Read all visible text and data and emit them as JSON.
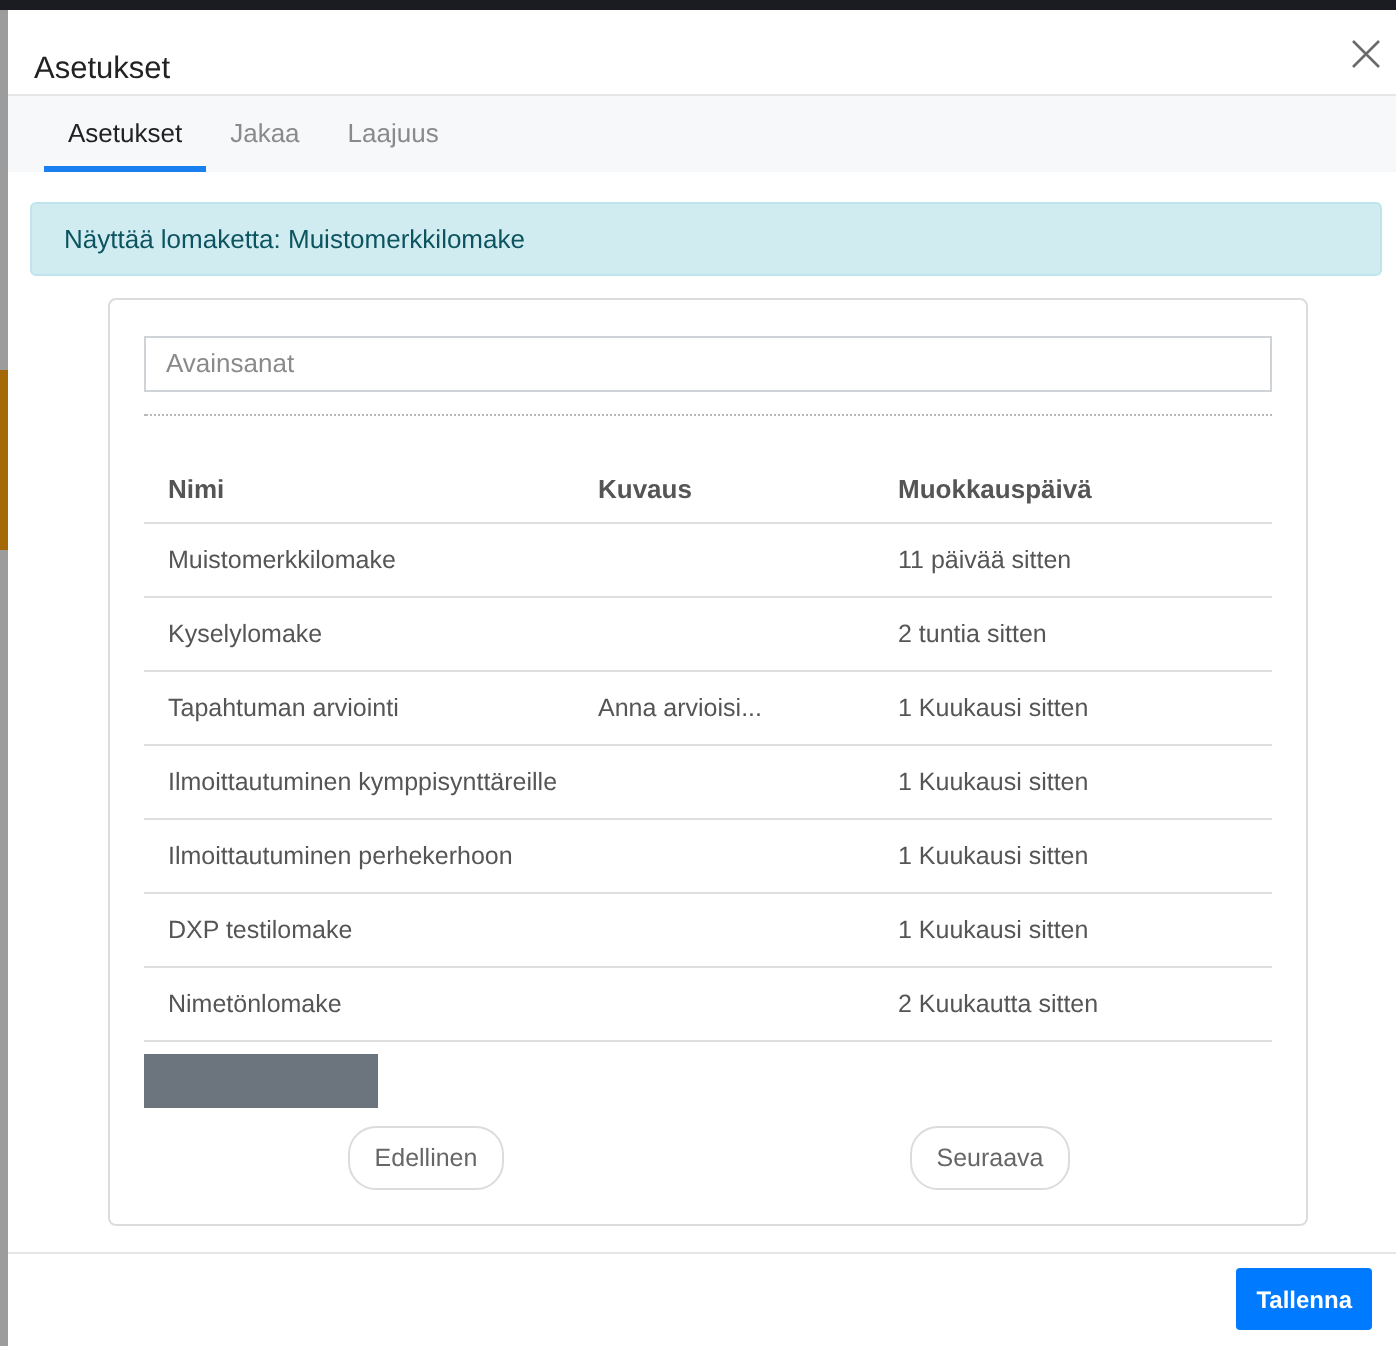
{
  "window": {
    "title": "Asetukset"
  },
  "tabs": [
    {
      "label": "Asetukset",
      "selected": true
    },
    {
      "label": "Jakaa",
      "selected": false
    },
    {
      "label": "Laajuus",
      "selected": false
    }
  ],
  "alert": {
    "text": "Näyttää lomaketta: Muistomerkkilomake"
  },
  "search": {
    "placeholder": "Avainsanat"
  },
  "table": {
    "columns": [
      "Nimi",
      "Kuvaus",
      "Muokkauspäivä"
    ],
    "rows": [
      {
        "name": "Muistomerkkilomake",
        "modified": "11 päivää sitten"
      },
      {
        "name": "Kyselylomake",
        "modified": "2 tuntia sitten"
      },
      {
        "name": "Tapahtuman arviointi",
        "description": "Anna arvioisi...",
        "modified": "1 Kuukausi sitten"
      },
      {
        "name": "Ilmoittautuminen kymppisynttäreille",
        "modified": "1 Kuukausi sitten"
      },
      {
        "name": "Ilmoittautuminen perhekerhoon",
        "modified": "1 Kuukausi sitten"
      },
      {
        "name": "DXP testilomake",
        "modified": "1 Kuukausi sitten"
      },
      {
        "name": "Nimetönlomake",
        "modified": "2 Kuukautta sitten"
      }
    ]
  },
  "pagination": {
    "previous": "Edellinen",
    "next": "Seuraava"
  },
  "footer": {
    "buttons": [
      "Tallenna"
    ]
  }
}
